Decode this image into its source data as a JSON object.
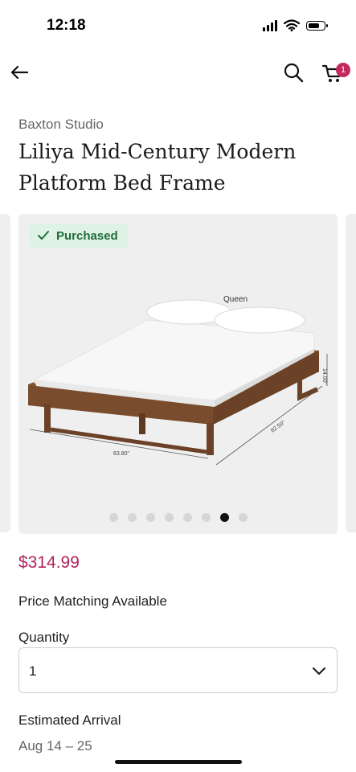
{
  "status": {
    "time": "12:18"
  },
  "nav": {
    "cart_count": "1"
  },
  "product": {
    "brand": "Baxton Studio",
    "title_line1": "Liliya Mid-Century Modern",
    "title_line2": "Platform Bed Frame",
    "badge": "Purchased",
    "image_labels": {
      "size": "Queen",
      "width": "63.80\"",
      "depth": "82.50\"",
      "height": "14.00\""
    },
    "gallery_total": 8,
    "gallery_active_index": 6,
    "price": "$314.99",
    "price_matching": "Price Matching Available",
    "quantity_label": "Quantity",
    "quantity_value": "1",
    "arrival_label": "Estimated Arrival",
    "arrival_date": "Aug 14 – 25"
  },
  "colors": {
    "accent": "#b1245a",
    "badge_bg": "#dff3e4",
    "badge_text": "#1f6b3a"
  },
  "icons": [
    "back-arrow-icon",
    "search-icon",
    "cart-icon",
    "checkmark-icon",
    "chevron-down-icon"
  ]
}
